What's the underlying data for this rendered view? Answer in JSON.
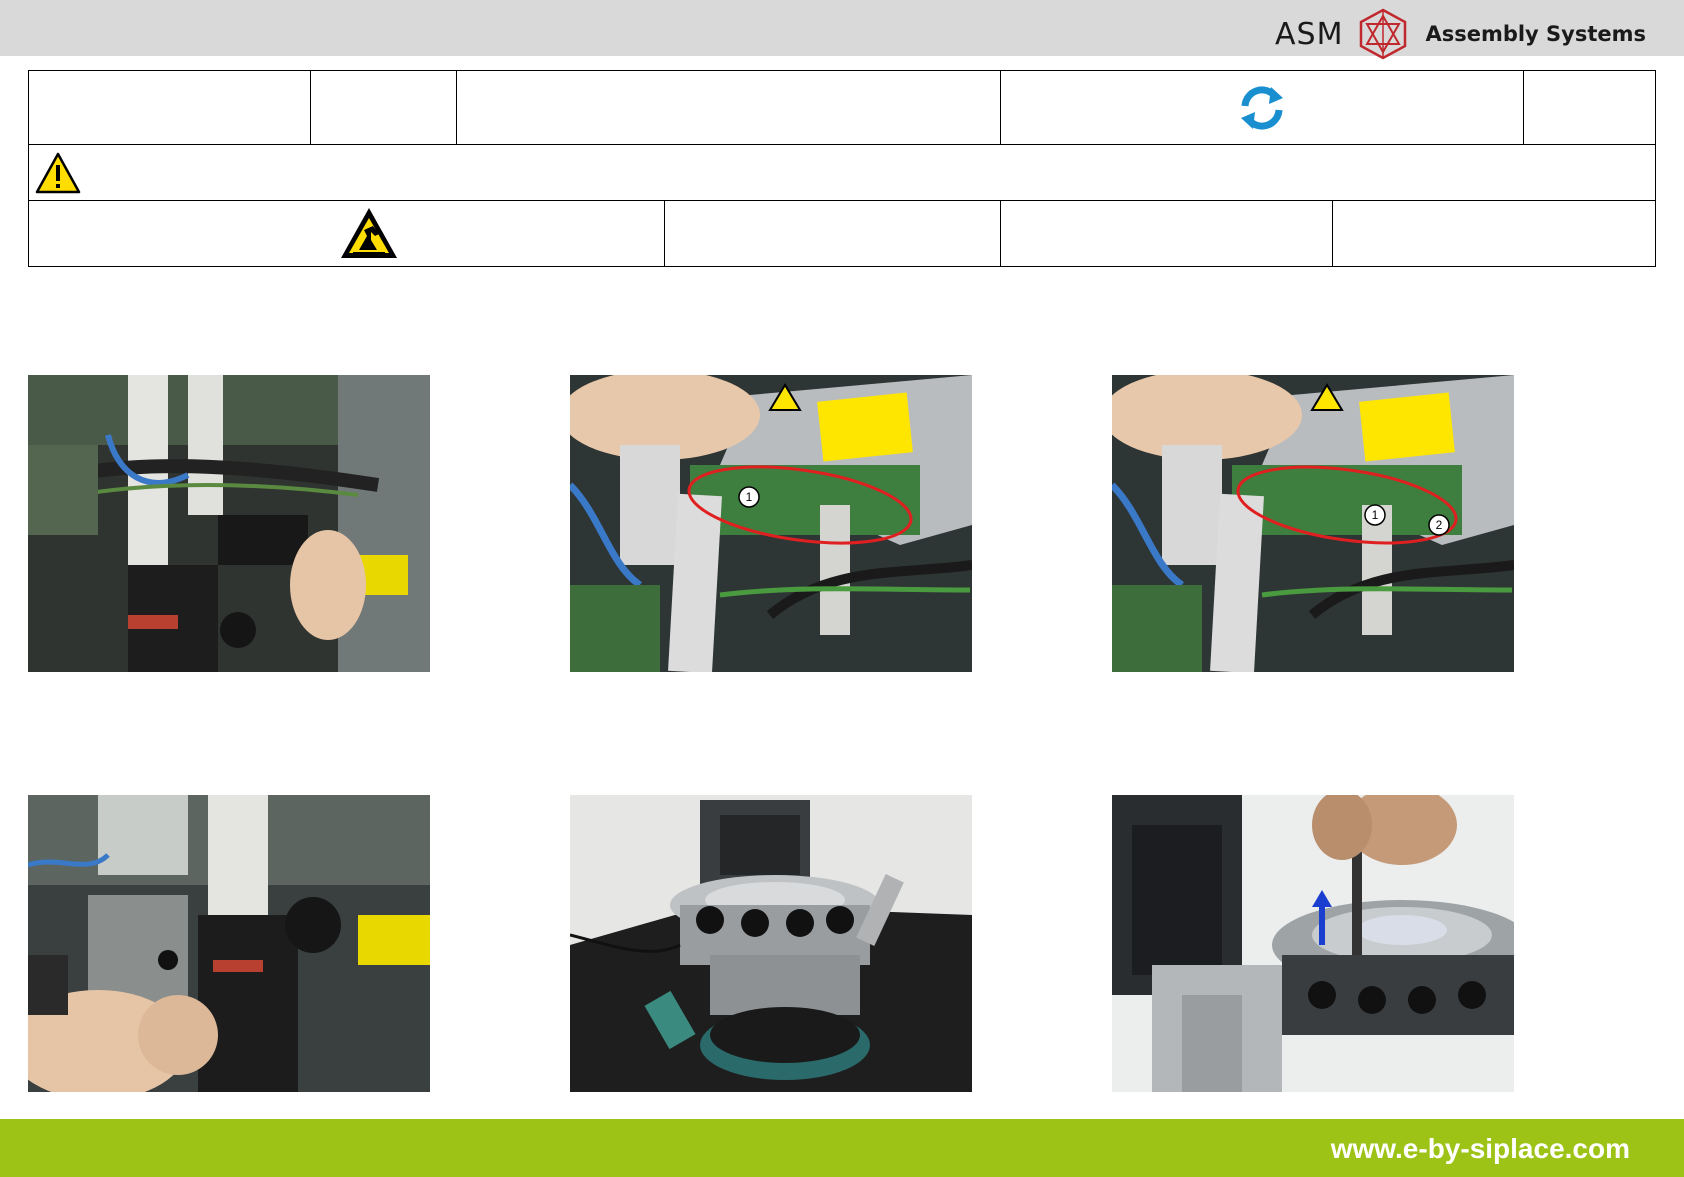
{
  "header": {
    "brand_name": "ASM",
    "brand_subtitle": "Assembly Systems",
    "logo_color": "#c0282d"
  },
  "info_table": {
    "refresh_icon": "refresh-icon",
    "refresh_color": "#1a8fd0",
    "warning_icon": "warning-triangle-icon",
    "esd_icon": "esd-warning-icon"
  },
  "photos": [
    {
      "icon": "photo-cable-removal"
    },
    {
      "icon": "photo-board-marker-1",
      "callouts": [
        "1"
      ]
    },
    {
      "icon": "photo-board-markers-1-2",
      "callouts": [
        "1",
        "2"
      ]
    },
    {
      "icon": "photo-head-unscrew"
    },
    {
      "icon": "photo-revolver-head"
    },
    {
      "icon": "photo-nozzle-removal"
    }
  ],
  "footer": {
    "url": "www.e-by-siplace.com",
    "bar_color": "#9ec317"
  }
}
